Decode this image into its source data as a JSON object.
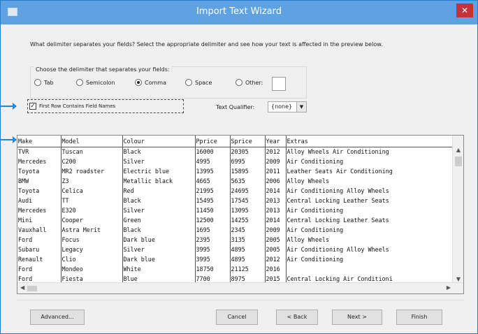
{
  "window": {
    "title": "Import Text Wizard",
    "close_glyph": "✕"
  },
  "question": "What delimiter separates your fields? Select the appropriate delimiter and see how your text is affected in the preview below.",
  "delimiter_group": {
    "label": "Choose the delimiter that separates your fields:",
    "options": [
      "Tab",
      "Semicolon",
      "Comma",
      "Space",
      "Other:"
    ],
    "selected": "Comma",
    "other_value": ""
  },
  "first_row_label": "First Row Contains Field Names",
  "first_row_checked": true,
  "text_qualifier": {
    "label": "Text Qualifier:",
    "value": "{none}"
  },
  "preview": {
    "headers": [
      "Make",
      "Model",
      "Colour",
      "Pprice",
      "Sprice",
      "Year",
      "Extras"
    ],
    "rows": [
      [
        "TVR",
        "Tuscan",
        "Black",
        "16000",
        "20305",
        "2012",
        "Alloy Wheels   Air Conditioning"
      ],
      [
        "Mercedes",
        "C200",
        "Silver",
        "4995",
        "6995",
        "2009",
        "Air Conditioning"
      ],
      [
        "Toyota",
        "MR2 roadster",
        "Electric blue",
        "13995",
        "15895",
        "2011",
        "Leather Seats   Air Conditioning"
      ],
      [
        "BMW",
        "Z3",
        "Metallic black",
        "4665",
        "5635",
        "2006",
        "Alloy Wheels"
      ],
      [
        "Toyota",
        "Celica",
        "Red",
        "21995",
        "24695",
        "2014",
        "Air Conditioning   Alloy Wheels"
      ],
      [
        "Audi",
        "TT",
        "Black",
        "15495",
        "17545",
        "2013",
        "Central Locking   Leather Seats"
      ],
      [
        "Mercedes",
        "E320",
        "Silver",
        "11450",
        "13095",
        "2013",
        "Air Conditioning"
      ],
      [
        "Mini",
        "Cooper",
        "Green",
        "12500",
        "14255",
        "2014",
        "Central Locking   Leather Seats"
      ],
      [
        "Vauxhall",
        "Astra Merit",
        "Black",
        "1695",
        "2345",
        "2009",
        "Air Conditioning"
      ],
      [
        "Ford",
        "Focus",
        "Dark blue",
        "2395",
        "3135",
        "2005",
        "Alloy Wheels"
      ],
      [
        "Subaru",
        "Legacy",
        "Silver",
        "3995",
        "4895",
        "2005",
        "Air Conditioning   Alloy Wheels"
      ],
      [
        "Renault",
        "Clio",
        "Dark blue",
        "3995",
        "4895",
        "2012",
        "Air Conditioning"
      ],
      [
        "Ford",
        "Mondeo",
        "White",
        "18750",
        "21125",
        "2016",
        ""
      ],
      [
        "Ford",
        "Fiesta",
        "Blue",
        "7700",
        "8975",
        "2015",
        "Central Locking   Air Conditioni"
      ]
    ]
  },
  "buttons": {
    "advanced": "Advanced...",
    "cancel": "Cancel",
    "back": "< Back",
    "next": "Next >",
    "finish": "Finish"
  },
  "colors": {
    "titlebar": "#5ea2e2",
    "close": "#c7313b",
    "arrow": "#1e88d8"
  }
}
